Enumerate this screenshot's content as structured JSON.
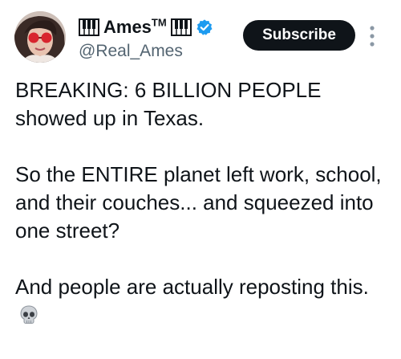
{
  "author": {
    "display_name": "Ames",
    "trademark": "TM",
    "handle": "@Real_Ames",
    "verified": true,
    "badge_color": "#1d9bf0"
  },
  "actions": {
    "subscribe_label": "Subscribe",
    "more_icon": "more-vertical-icon"
  },
  "post": {
    "paragraphs": [
      "BREAKING: 6 BILLION PEOPLE showed up in Texas.",
      "So the ENTIRE planet left work, school, and their couches... and squeezed into one street?",
      "And people are actually reposting this."
    ],
    "trailing_emoji": "skull-icon"
  }
}
